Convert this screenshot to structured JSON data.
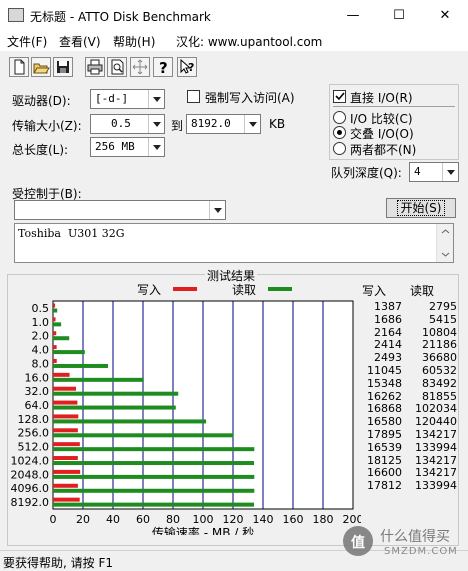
{
  "window": {
    "title": "无标题 - ATTO Disk Benchmark",
    "controls": [
      "—",
      "☐",
      "✕"
    ]
  },
  "menu": {
    "file": "文件(F)",
    "view": "查看(V)",
    "help": "帮助(H)",
    "localized": "汉化: www.upantool.com"
  },
  "toolbar": {
    "icons": [
      "new-icon",
      "open-icon",
      "save-icon",
      "print-icon",
      "print-preview-icon",
      "move-icon",
      "help-icon",
      "context-help-icon"
    ]
  },
  "settings": {
    "drive_label": "驱动器(D):",
    "drive_value": "[-d-]",
    "transfer_label": "传输大小(Z):",
    "transfer_from": "0.5",
    "transfer_to_label": "到",
    "transfer_to": "8192.0",
    "transfer_unit": "KB",
    "total_length_label": "总长度(L):",
    "total_length_value": "256 MB",
    "force_write_label": "强制写入访问(A)",
    "force_write_checked": false,
    "direct_io_label": "直接 I/O(R)",
    "direct_io_checked": true,
    "io_compare_label": "I/O 比较(C)",
    "overlap_io_label": "交叠 I/O(O)",
    "neither_label": "两者都不(N)",
    "selected_mode": "overlap_io",
    "queue_depth_label": "队列深度(Q):",
    "queue_depth_value": "4",
    "controlled_by_label": "受控制于(B):",
    "controlled_by_value": "",
    "start_button": "开始(S)",
    "description": "Toshiba  U301 32G"
  },
  "results": {
    "title": "测试结果",
    "legend_write": "写入",
    "legend_read": "读取",
    "write_color": "#e02020",
    "read_color": "#1e8c1e",
    "col_write": "写入",
    "col_read": "读取",
    "rows": [
      {
        "size": "0.5",
        "write": "1387",
        "read": "2795"
      },
      {
        "size": "1.0",
        "write": "1686",
        "read": "5415"
      },
      {
        "size": "2.0",
        "write": "2164",
        "read": "10804"
      },
      {
        "size": "4.0",
        "write": "2414",
        "read": "21186"
      },
      {
        "size": "8.0",
        "write": "2493",
        "read": "36680"
      },
      {
        "size": "16.0",
        "write": "11045",
        "read": "60532"
      },
      {
        "size": "32.0",
        "write": "15348",
        "read": "83492"
      },
      {
        "size": "64.0",
        "write": "16262",
        "read": "81855"
      },
      {
        "size": "128.0",
        "write": "16868",
        "read": "102034"
      },
      {
        "size": "256.0",
        "write": "16580",
        "read": "120440"
      },
      {
        "size": "512.0",
        "write": "17895",
        "read": "134217"
      },
      {
        "size": "1024.0",
        "write": "16539",
        "read": "133994"
      },
      {
        "size": "2048.0",
        "write": "18125",
        "read": "134217"
      },
      {
        "size": "4096.0",
        "write": "16600",
        "read": "134217"
      },
      {
        "size": "8192.0",
        "write": "17812",
        "read": "133994"
      }
    ]
  },
  "chart_data": {
    "type": "bar",
    "orientation": "horizontal",
    "categories": [
      "0.5",
      "1.0",
      "2.0",
      "4.0",
      "8.0",
      "16.0",
      "32.0",
      "64.0",
      "128.0",
      "256.0",
      "512.0",
      "1024.0",
      "2048.0",
      "4096.0",
      "8192.0"
    ],
    "series": [
      {
        "name": "写入",
        "values": [
          1.387,
          1.686,
          2.164,
          2.414,
          2.493,
          11.045,
          15.348,
          16.262,
          16.868,
          16.58,
          17.895,
          16.539,
          18.125,
          16.6,
          17.812
        ]
      },
      {
        "name": "读取",
        "values": [
          2.795,
          5.415,
          10.804,
          21.186,
          36.68,
          60.532,
          83.492,
          81.855,
          102.034,
          120.44,
          134.217,
          133.994,
          134.217,
          134.217,
          133.994
        ]
      }
    ],
    "xlabel": "传输速率 - MB / 秒",
    "xlim": [
      0,
      200
    ],
    "xticks": [
      "0",
      "20",
      "40",
      "60",
      "80",
      "100",
      "120",
      "140",
      "160",
      "180",
      "200"
    ],
    "grid": true,
    "legend_position": "top"
  },
  "status": {
    "text": "要获得帮助, 请按 F1"
  },
  "watermark": {
    "glyph": "值",
    "text": "什么值得买",
    "sub": "SMZDM.COM"
  }
}
